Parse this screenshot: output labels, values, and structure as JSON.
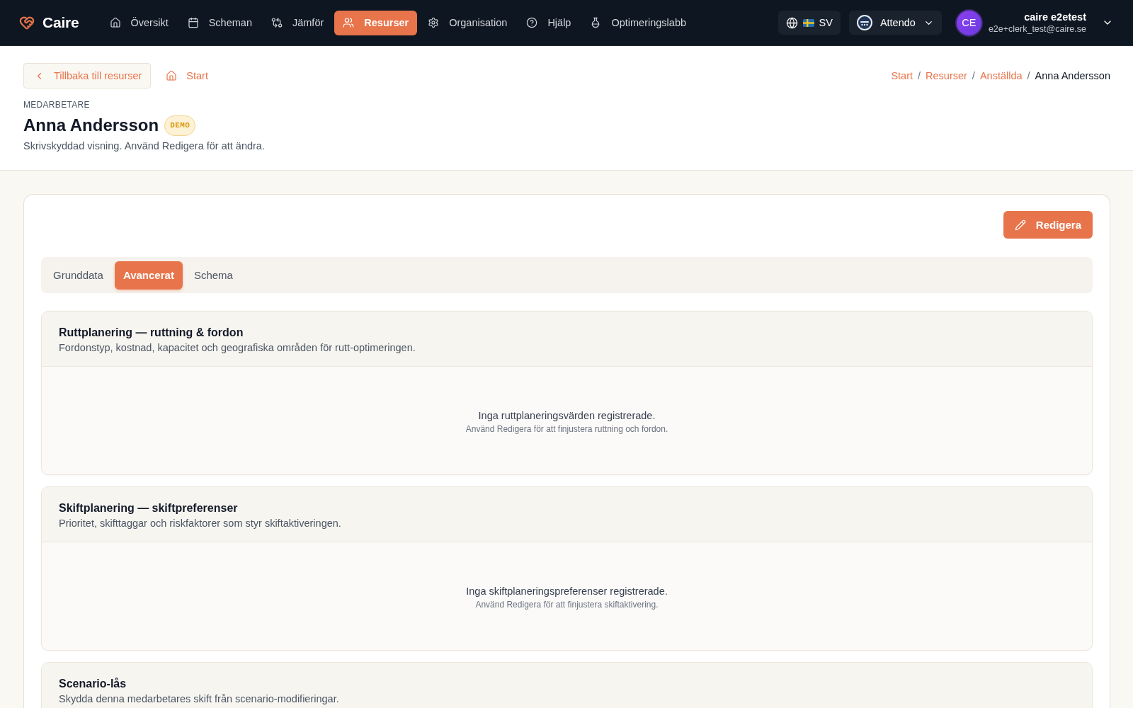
{
  "nav": {
    "brand": "Caire",
    "items": [
      {
        "label": "Översikt",
        "selected": false
      },
      {
        "label": "Scheman",
        "selected": false
      },
      {
        "label": "Jämför",
        "selected": false
      },
      {
        "label": "Resurser",
        "selected": true
      },
      {
        "label": "Organisation",
        "selected": false
      },
      {
        "label": "Hjälp",
        "selected": false
      },
      {
        "label": "Optimeringslabb",
        "selected": false
      }
    ],
    "language": "SV",
    "organization": "Attendo",
    "user": {
      "initials": "CE",
      "name": "caire e2etest",
      "email": "e2e+clerk_test@caire.se"
    }
  },
  "header": {
    "back_button": "Tillbaka till resurser",
    "home_link": "Start",
    "breadcrumb": [
      {
        "label": "Start",
        "current": false,
        "separator": "/"
      },
      {
        "label": "Resurser",
        "current": false,
        "separator": "/"
      },
      {
        "label": "Anställda",
        "current": false,
        "separator": "/"
      },
      {
        "label": "Anna Andersson",
        "current": true
      }
    ],
    "eyebrow": "MEDARBETARE",
    "title": "Anna Andersson",
    "badge": "DEMO",
    "subtitle": "Skrivskyddad visning. Använd Redigera för att ändra."
  },
  "card": {
    "edit_button": "Redigera",
    "tabs": [
      {
        "label": "Grunddata",
        "selected": false
      },
      {
        "label": "Avancerat",
        "selected": true
      },
      {
        "label": "Schema",
        "selected": false
      }
    ],
    "sections": [
      {
        "title": "Ruttplanering — ruttning & fordon",
        "description": "Fordonstyp, kostnad, kapacitet och geografiska områden för rutt-optimeringen.",
        "empty_title": "Inga ruttplaneringsvärden registrerade.",
        "empty_hint": "Använd Redigera för att finjustera ruttning och fordon."
      },
      {
        "title": "Skiftplanering — skiftpreferenser",
        "description": "Prioritet, skifttaggar och riskfaktorer som styr skiftaktiveringen.",
        "empty_title": "Inga skiftplaneringspreferenser registrerade.",
        "empty_hint": "Använd Redigera för att finjustera skiftaktivering."
      },
      {
        "title": "Scenario-lås",
        "description": "Skydda denna medarbetares skift från scenario-modifieringar."
      }
    ]
  }
}
